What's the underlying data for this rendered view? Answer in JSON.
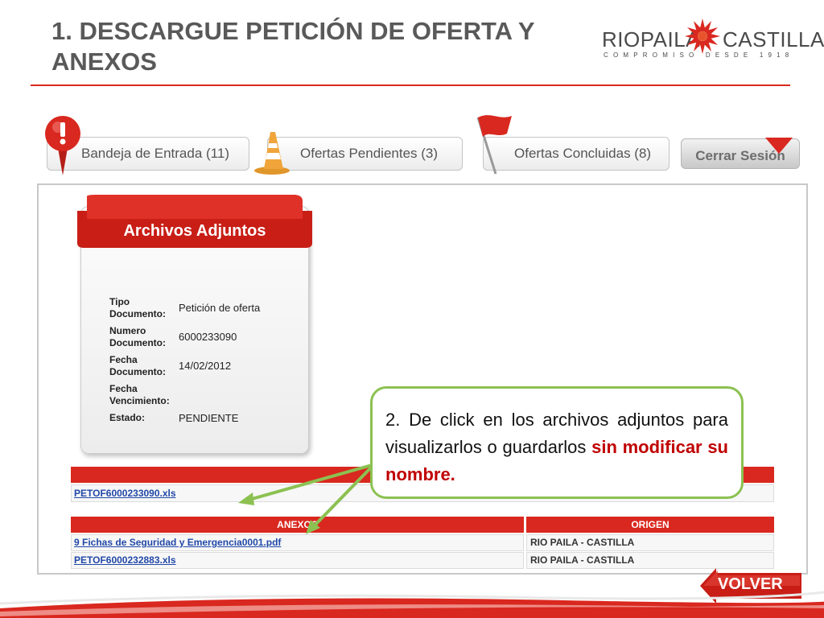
{
  "slide": {
    "title": "1. DESCARGUE PETICIÓN DE OFERTA Y ANEXOS"
  },
  "logo": {
    "left_word": "RIOPAILA",
    "right_word": "CASTILLA",
    "tagline": "COMPROMISO DESDE 1918"
  },
  "nav": {
    "inbox_label": "Bandeja de Entrada (11)",
    "pending_label": "Ofertas Pendientes (3)",
    "concluded_label": "Ofertas Concluidas (8)",
    "logout_label": "Cerrar Sesión"
  },
  "attachments_card": {
    "title": "Archivos Adjuntos",
    "fields": [
      {
        "label": "Tipo Documento:",
        "value": "Petición de oferta"
      },
      {
        "label": "Numero Documento:",
        "value": "6000233090"
      },
      {
        "label": "Fecha Documento:",
        "value": "14/02/2012"
      },
      {
        "label": "Fecha Vencimiento:",
        "value": ""
      },
      {
        "label": "Estado:",
        "value": "PENDIENTE"
      }
    ]
  },
  "main_file": {
    "file": "PETOF6000233090.xls"
  },
  "annexes": {
    "header_annex": "ANEXOS",
    "header_origin": "ORIGEN",
    "rows": [
      {
        "file": "9 Fichas de Seguridad y Emergencia0001.pdf",
        "origin": "RIO PAILA - CASTILLA"
      },
      {
        "file": "PETOF6000232883.xls",
        "origin": "RIO PAILA - CASTILLA"
      }
    ]
  },
  "callout": {
    "text_plain": "2. De click en los archivos adjuntos para visualizarlos o guardarlos ",
    "text_emphasis": "sin modificar su nombre."
  },
  "back_button": {
    "label": "VOLVER"
  },
  "colors": {
    "brand_red": "#d9281f",
    "callout_border": "#8cc152",
    "emphasis_red": "#c00000",
    "link_blue": "#2148a8"
  }
}
